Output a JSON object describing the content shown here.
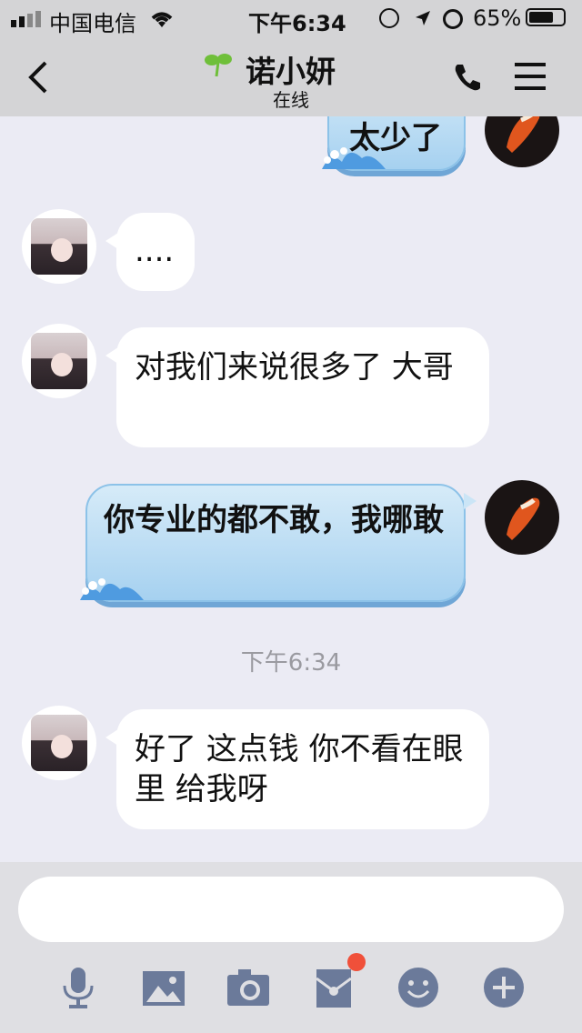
{
  "status_bar": {
    "carrier": "中国电信",
    "time": "下午6:34",
    "battery": "65%"
  },
  "header": {
    "contact_name": "诺小妍",
    "status": "在线"
  },
  "messages": [
    {
      "side": "right",
      "text": "太少了"
    },
    {
      "side": "left",
      "text": "...."
    },
    {
      "side": "left",
      "text": "对我们来说很多了  大哥"
    },
    {
      "side": "right",
      "text": "你专业的都不敢，我哪敢"
    },
    {
      "side": "left",
      "text": "好了 这点钱 你不看在眼里 给我呀"
    }
  ],
  "timestamp": "下午6:34",
  "composer": {
    "placeholder": "",
    "tools": [
      "microphone-icon",
      "image-icon",
      "camera-icon",
      "red-packet-icon",
      "emoji-icon",
      "plus-icon"
    ]
  },
  "colors": {
    "accent": "#6b7a9a",
    "badge": "#f0503a",
    "bubble_right": "#a6d1f0"
  }
}
